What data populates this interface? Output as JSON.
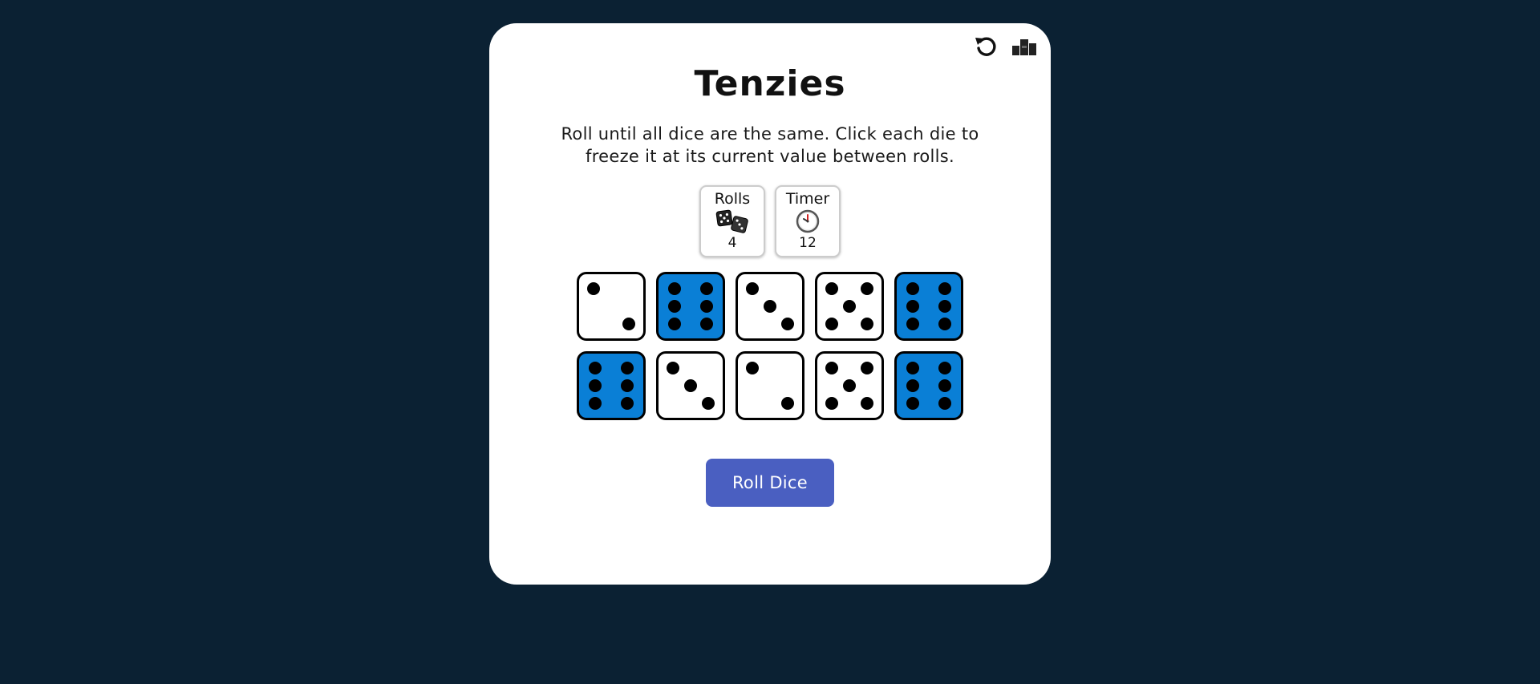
{
  "header": {
    "title": "Tenzies",
    "instructions": "Roll until all dice are the same. Click each die to freeze it at its current value between rolls.",
    "icons": [
      "reset-icon",
      "leaderboard-icon"
    ]
  },
  "stats": {
    "rolls": {
      "label": "Rolls",
      "icon": "dice-icon",
      "value": "4"
    },
    "timer": {
      "label": "Timer",
      "icon": "clock-icon",
      "value": "12"
    }
  },
  "dice": [
    {
      "value": 2,
      "held": false
    },
    {
      "value": 6,
      "held": true
    },
    {
      "value": 3,
      "held": false
    },
    {
      "value": 5,
      "held": false
    },
    {
      "value": 6,
      "held": true
    },
    {
      "value": 6,
      "held": true
    },
    {
      "value": 3,
      "held": false
    },
    {
      "value": 2,
      "held": false
    },
    {
      "value": 5,
      "held": false
    },
    {
      "value": 6,
      "held": true
    }
  ],
  "actions": {
    "roll_label": "Roll Dice"
  },
  "colors": {
    "background": "#0b2133",
    "card": "#ffffff",
    "held_die": "#0a7fd6",
    "button": "#4a5fc1"
  }
}
